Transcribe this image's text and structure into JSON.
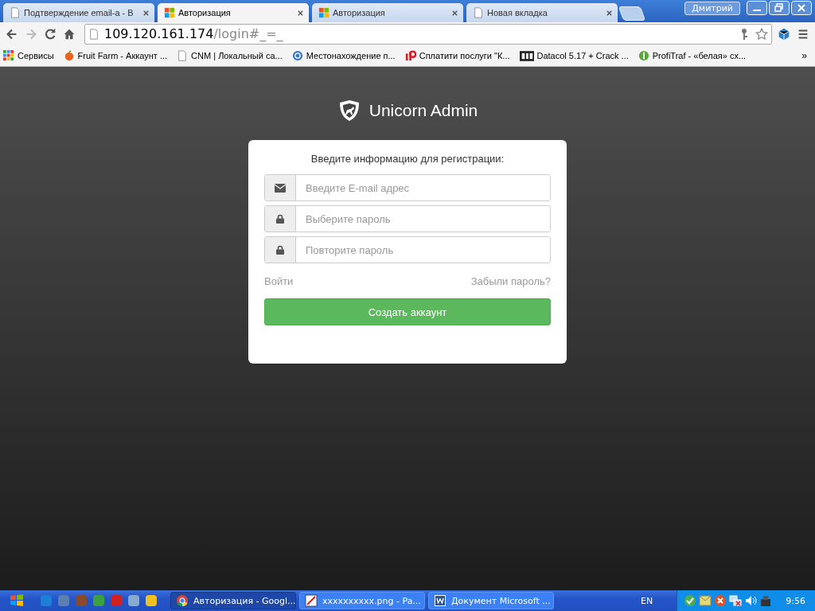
{
  "browser": {
    "tabs": [
      {
        "title": "Подтверждение email-a - B",
        "selected": false,
        "kind": "page"
      },
      {
        "title": "Авторизация",
        "selected": true,
        "kind": "site"
      },
      {
        "title": "Авторизация",
        "selected": false,
        "kind": "site"
      },
      {
        "title": "Новая вкладка",
        "selected": false,
        "kind": "page"
      }
    ],
    "profile": "Дмитрий",
    "url": {
      "host": "109.120.161.174",
      "path": "/login#_=_"
    },
    "bookmarks": [
      {
        "title": "Сервисы",
        "kind": "apps"
      },
      {
        "title": "Fruit Farm - Аккаунт ...",
        "kind": "fruit",
        "color": "#e8641c"
      },
      {
        "title": "CNM | Локальный са...",
        "kind": "page"
      },
      {
        "title": "Местонахождение п...",
        "kind": "globe",
        "color": "#3a7bc8"
      },
      {
        "title": "Сплатити послуги \"К...",
        "kind": "ip",
        "color": "#d0202a"
      },
      {
        "title": "Datacol 5.17 + Crack ...",
        "kind": "dc",
        "color": "#222222"
      },
      {
        "title": "ProfiTraf - «белая» сх...",
        "kind": "coin",
        "color": "#5aa83a"
      }
    ],
    "more": "»"
  },
  "page": {
    "brand": "Unicorn Admin",
    "heading": "Введите информацию для регистрации:",
    "fields": [
      {
        "kind": "email",
        "placeholder": "Введите E-mail адрес"
      },
      {
        "kind": "password",
        "placeholder": "Выберите пароль"
      },
      {
        "kind": "password",
        "placeholder": "Повторите пароль"
      }
    ],
    "login_link": "Войти",
    "forgot_link": "Забыли пароль?",
    "submit": "Создать аккаунт"
  },
  "taskbar": {
    "quick_launch": [
      {
        "color": "#1e7fd6"
      },
      {
        "color": "#5a7fb0"
      },
      {
        "color": "#8a4a2a"
      },
      {
        "color": "#3aa040"
      },
      {
        "color": "#d02020"
      },
      {
        "color": "#88aacc"
      },
      {
        "color": "#f0c020"
      }
    ],
    "tasks": [
      {
        "title": "Авторизация - Googl...",
        "selected": true,
        "kind": "chrome"
      },
      {
        "title": "xxxxxxxxxx.png - Pa...",
        "selected": false,
        "kind": "paint"
      },
      {
        "title": "Документ Microsoft ...",
        "selected": false,
        "kind": "word"
      }
    ],
    "language": "EN",
    "clock": "9:56"
  }
}
